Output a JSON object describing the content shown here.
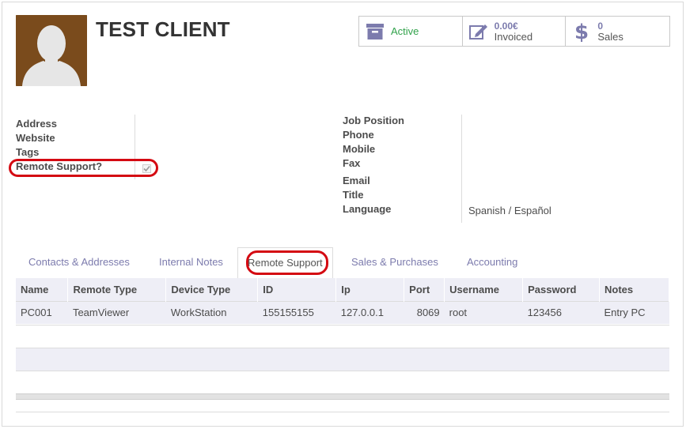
{
  "client": {
    "name": "TEST CLIENT"
  },
  "stats": {
    "active_label": "Active",
    "invoiced_value": "0.00€",
    "invoiced_label": "Invoiced",
    "sales_value": "0",
    "sales_label": "Sales"
  },
  "left_fields": {
    "address": "Address",
    "website": "Website",
    "tags": "Tags",
    "remote_support": "Remote Support?",
    "remote_support_checked": true
  },
  "right_fields": {
    "job_position": "Job Position",
    "phone": "Phone",
    "mobile": "Mobile",
    "fax": "Fax",
    "email": "Email",
    "title": "Title",
    "language": "Language",
    "language_value": "Spanish / Español"
  },
  "tabs": [
    {
      "label": "Contacts & Addresses"
    },
    {
      "label": "Internal Notes"
    },
    {
      "label": "Remote Support"
    },
    {
      "label": "Sales & Purchases"
    },
    {
      "label": "Accounting"
    }
  ],
  "table": {
    "columns": [
      "Name",
      "Remote Type",
      "Device Type",
      "ID",
      "Ip",
      "Port",
      "Username",
      "Password",
      "Notes"
    ],
    "rows": [
      [
        "PC001",
        "TeamViewer",
        "WorkStation",
        "155155155",
        "127.0.0.1",
        "8069",
        "root",
        "123456",
        "Entry PC"
      ]
    ]
  },
  "colors": {
    "accent": "#7c7bad",
    "active": "#31a24b",
    "highlight": "#d40a12",
    "avatar_bg": "#7a4b1c"
  }
}
